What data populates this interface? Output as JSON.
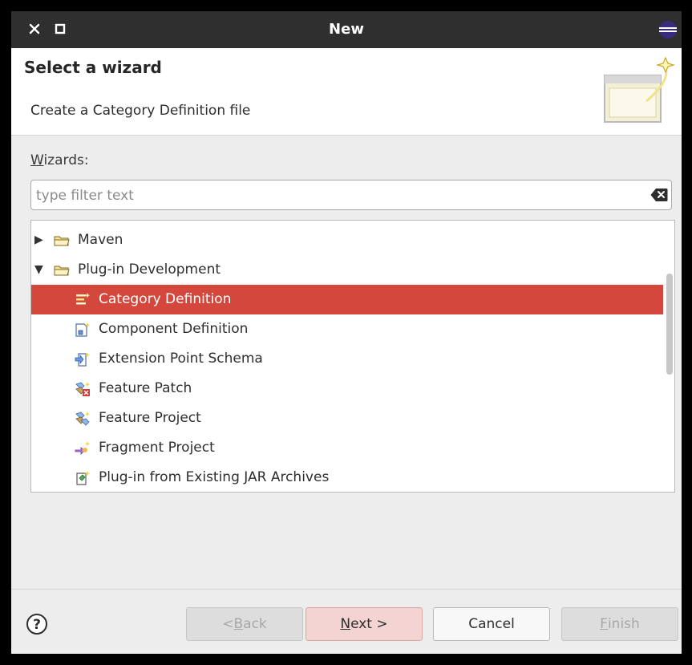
{
  "window": {
    "title": "New"
  },
  "banner": {
    "heading": "Select a wizard",
    "description": "Create a Category Definition file"
  },
  "wizards": {
    "label_mnemonic": "W",
    "label_rest": "izards:",
    "filter_placeholder": "type filter text"
  },
  "tree": {
    "rows": [
      {
        "label": "Maven",
        "type": "folder",
        "expanded": false,
        "icon": "folder-icon"
      },
      {
        "label": "Plug-in Development",
        "type": "folder",
        "expanded": true,
        "icon": "folder-open-icon"
      },
      {
        "label": "Category Definition",
        "type": "item",
        "selected": true,
        "icon": "category-definition-icon"
      },
      {
        "label": "Component Definition",
        "type": "item",
        "icon": "component-definition-icon"
      },
      {
        "label": "Extension Point Schema",
        "type": "item",
        "icon": "extension-point-schema-icon"
      },
      {
        "label": "Feature Patch",
        "type": "item",
        "icon": "feature-patch-icon"
      },
      {
        "label": "Feature Project",
        "type": "item",
        "icon": "feature-project-icon"
      },
      {
        "label": "Fragment Project",
        "type": "item",
        "icon": "fragment-project-icon"
      },
      {
        "label": "Plug-in from Existing JAR Archives",
        "type": "item",
        "icon": "jar-plugin-icon"
      }
    ],
    "scroll_fraction": 0.31
  },
  "buttons": {
    "back": {
      "prefix": "< ",
      "mnemonic": "B",
      "rest": "ack",
      "enabled": false
    },
    "next": {
      "prefix": "",
      "mnemonic": "N",
      "rest": "ext >",
      "enabled": true
    },
    "cancel": {
      "label": "Cancel",
      "enabled": true
    },
    "finish": {
      "prefix": "",
      "mnemonic": "F",
      "rest": "inish",
      "enabled": false
    }
  },
  "colors": {
    "selection": "#d4473c",
    "titlebar": "#2f2f2f",
    "primary_button": "#f3d4d2"
  }
}
